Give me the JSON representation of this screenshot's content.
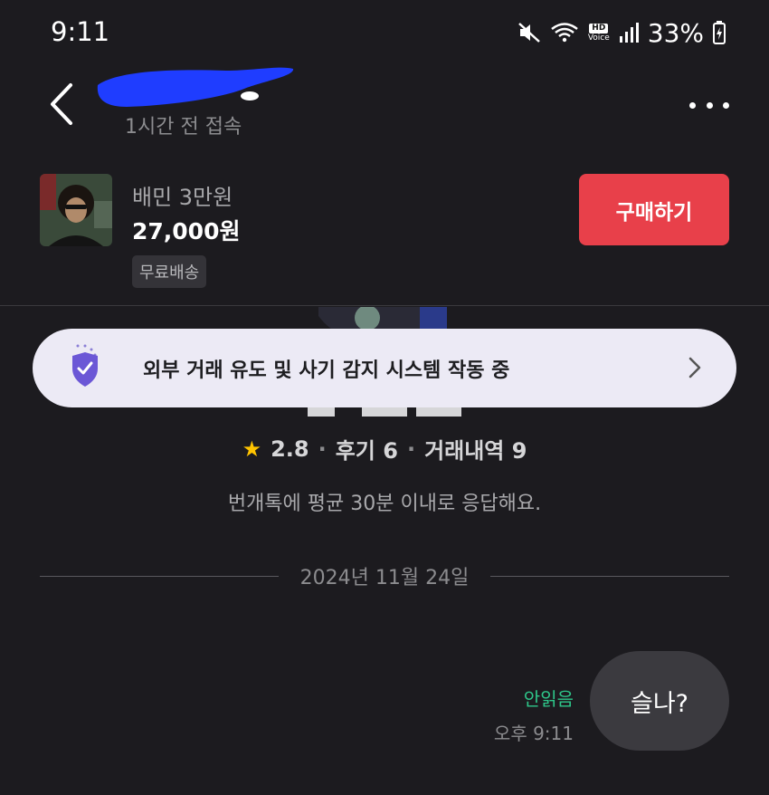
{
  "status_bar": {
    "time": "9:11",
    "battery": "33%",
    "icons": [
      "mute-vibrate-icon",
      "wifi-icon",
      "hd-voice-icon",
      "signal-icon",
      "battery-charging-icon"
    ],
    "hd_label": "HD",
    "voice_label": "Voice"
  },
  "header": {
    "last_seen": "1시간 전 접속"
  },
  "product": {
    "title": "배민 3만원",
    "price": "27,000원",
    "badge": "무료배송",
    "buy_label": "구매하기"
  },
  "safety_banner": {
    "text": "외부 거래 유도 및 사기 감지 시스템 작동 중"
  },
  "seller_stats": {
    "rating": "2.8",
    "reviews": "후기 6",
    "transactions": "거래내역 9",
    "separator": "·"
  },
  "response_info": "번개톡에 평균 30분 이내로 응답해요.",
  "date_divider": "2024년 11월 24일",
  "message": {
    "text": "슬나?",
    "status": "안읽음",
    "time": "오후 9:11"
  },
  "colors": {
    "background": "#1c1b1f",
    "buy_button": "#e8404a",
    "unread_status": "#2ec78a",
    "shield": "#6b57d6",
    "banner_bg": "#eceaf5"
  }
}
